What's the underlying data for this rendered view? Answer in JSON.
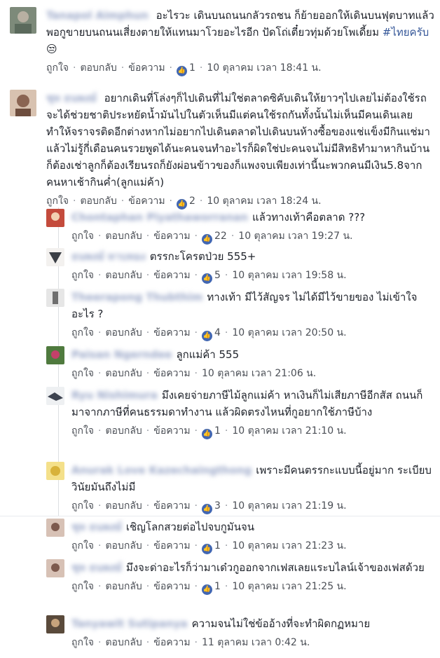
{
  "comments": [
    {
      "name": "Tanapol Aimphun",
      "text": "อะไรวะ เดินบนถนนกลัวรถชน ก็ย้ายออกให้เดินบนฟุตบาทแล้ว พอกูขายบนถนนเสี่ยงตายให้แทนมาโวยอะไรอีก ปัดโถ่เตี๋ยวทุ่มด้วยโพเดี้ยม",
      "hashtag": "#ไทยครับ",
      "emoji": "😒",
      "actions": {
        "like": "ถูกใจ",
        "reply": "ตอบกลับ",
        "message": "ข้อความ"
      },
      "likes": "1",
      "time": "10 ตุลาคม เวลา 18:41 น."
    },
    {
      "name": "ชุท ธนพงษ์",
      "text": "อยากเดินที่โล่งๆก็ไปเดินที่ไม่ใช่ตลาดซิคับเดินให้ยาวๆไปเลยไม่ต้องใช้รถจะได้ช่วยชาติประหยัดน้ำมันไปในตัวเห็นมีแต่คนใช้รถกันทั้งนั้นไม่เห็นมีคนเดินเลยทำให้จราจรติดอีกต่างหากไม่อยากไปเดินตลาดไปเดินบนห้างซื้อของแช่แข็งมีกินแช่มาแล้วไม่รู้กี่เดือนคนรวยพูดได้นะคนจนทำอะไรก็ผิดใช่ปะคนจนไม่มีสิทธิทำมาหากินบ้านก็ต้องเช่าลูกก็ต้องเรียนรถก็ยังผ่อนข้าวของก็แพงจบเพียงเท่านี้นะพวกคนมีเงิน5.8จากคนหาเช้ากินค่ำ(ลูกแม่ค้า)",
      "actions": {
        "like": "ถูกใจ",
        "reply": "ตอบกลับ",
        "message": "ข้อความ"
      },
      "likes": "2",
      "time": "10 ตุลาคม เวลา 18:24 น."
    }
  ],
  "replies": [
    {
      "name": "Chontaphan Piyathaworranan",
      "text": "แล้วทางเท้าคือตลาด ???",
      "likes": "22",
      "time": "10 ตุลาคม เวลา 19:27 น."
    },
    {
      "name": "ธนพงษ์ ทาบทอง",
      "text": "ตรรกะโครตป่วย 555+",
      "likes": "5",
      "time": "10 ตุลาคม เวลา 19:58 น."
    },
    {
      "name": "Theerapong Thubthim",
      "text": "ทางเท้า มีไว้สัญจร ไม่ได้มีไว้ขายของ ไม่เข้าใจอะไร ?",
      "likes": "4",
      "time": "10 ตุลาคม เวลา 20:50 น."
    },
    {
      "name": "Paisan Ngerndee",
      "text": "ลูกแม่ค้า 555",
      "likes": "",
      "time": "10 ตุลาคม เวลา 21:06 น."
    },
    {
      "name": "Ryu Nishimura",
      "text": "มึงเคยจ่ายภาษีไม้ลูกแม่ค้า หาเงินก็ไม่เสียภาษีอีกสัส ถนนก็มาจากภาษีที่คนธรรมดาทำงาน แล้วผิดตรงไหนที่กูอยากใช้ภาษีบ้าง",
      "likes": "1",
      "time": "10 ตุลาคม เวลา 21:10 น."
    },
    {
      "name": "Anurak Love Kazechaingthong",
      "text": "เพราะมีคนตรรกะแบบนี้อยู่มาก ระเบียบวินัยมันถึงไม่มี",
      "likes": "3",
      "time": "10 ตุลาคม เวลา 21:19 น."
    },
    {
      "name": "ชุท ธนพงษ์",
      "text": "เชิญโลกสวยต่อไปจบกูมันจน",
      "likes": "1",
      "time": "10 ตุลาคม เวลา 21:23 น."
    },
    {
      "name": "ชุท ธนพงษ์",
      "text": "มึงจะด่าอะไรก็ว่ามาเด๋วกูออกจากเฟสเลยแระบไลน์เจ้าของเฟสด้วย",
      "likes": "1",
      "time": "10 ตุลาคม เวลา 21:25 น."
    },
    {
      "name": "Tanyawit Sutipanya",
      "text": "ความจนไม่ใช่ข้ออ้างที่จะทำผิดกฏหมาย",
      "likes": "",
      "time": "11 ตุลาคม เวลา 0:42 น."
    }
  ],
  "actions": {
    "like": "ถูกใจ",
    "reply": "ตอบกลับ",
    "message": "ข้อความ"
  },
  "colors": {
    "link": "#365899",
    "meta": "#616770",
    "like_blue": "#4267b2",
    "thread_line": "#dddfe2"
  },
  "icons": {
    "like": "thumbs-up-icon"
  }
}
